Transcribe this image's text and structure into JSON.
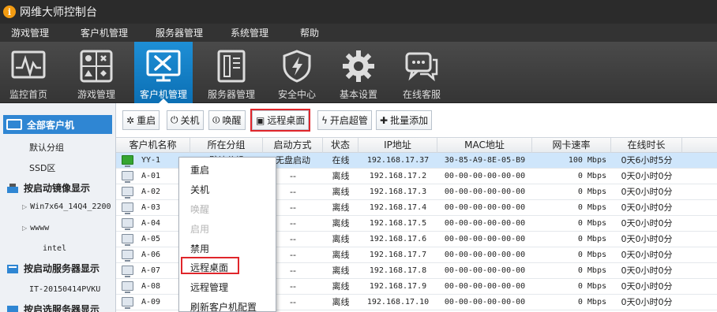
{
  "app": {
    "title": "网维大师控制台",
    "logo_glyph": "i"
  },
  "menu": [
    "游戏管理",
    "客户机管理",
    "服务器管理",
    "系统管理",
    "帮助"
  ],
  "toolbar": [
    {
      "label": "监控首页",
      "icon": "monitor-chart-icon"
    },
    {
      "label": "游戏管理",
      "icon": "game-cards-icon"
    },
    {
      "label": "客户机管理",
      "icon": "client-tools-icon",
      "active": true
    },
    {
      "label": "服务器管理",
      "icon": "server-icon"
    },
    {
      "label": "安全中心",
      "icon": "shield-bolt-icon"
    },
    {
      "label": "基本设置",
      "icon": "gear-icon"
    },
    {
      "label": "在线客服",
      "icon": "chat-icon"
    }
  ],
  "sidebar": {
    "all_clients": "全部客户机",
    "groups": [
      "默认分组",
      "SSD区"
    ],
    "boot_image_header": "按启动镜像显示",
    "images": [
      "Win7x64_14Q4_2200",
      "wwww",
      "intel"
    ],
    "boot_server_header": "按启动服务器显示",
    "servers": [
      "IT-20150414PVKU"
    ],
    "last_header": "按启选服务器显示"
  },
  "actions": [
    {
      "label": "重启",
      "glyph": "✲"
    },
    {
      "label": "关机",
      "glyph": "⏻"
    },
    {
      "label": "唤醒",
      "glyph": "⏼"
    },
    {
      "label": "远程桌面",
      "glyph": "▣"
    },
    {
      "label": "开启超管",
      "glyph": "ϟ"
    },
    {
      "label": "批量添加",
      "glyph": "✚"
    }
  ],
  "table": {
    "columns": [
      "客户机名称",
      "所在分组",
      "启动方式",
      "状态",
      "IP地址",
      "MAC地址",
      "网卡速率",
      "在线时长"
    ],
    "rows": [
      {
        "name": "YY-1",
        "group": "默认分组",
        "boot": "无盘启动",
        "status": "在线",
        "ip": "192.168.17.37",
        "mac": "30-85-A9-8E-05-B9",
        "speed": "100 Mbps",
        "uptime": "0天6小时5分",
        "online": true
      },
      {
        "name": "A-01",
        "group": "",
        "boot": "--",
        "status": "离线",
        "ip": "192.168.17.2",
        "mac": "00-00-00-00-00-00",
        "speed": "0 Mbps",
        "uptime": "0天0小时0分"
      },
      {
        "name": "A-02",
        "group": "",
        "boot": "--",
        "status": "离线",
        "ip": "192.168.17.3",
        "mac": "00-00-00-00-00-00",
        "speed": "0 Mbps",
        "uptime": "0天0小时0分"
      },
      {
        "name": "A-03",
        "group": "",
        "boot": "--",
        "status": "离线",
        "ip": "192.168.17.4",
        "mac": "00-00-00-00-00-00",
        "speed": "0 Mbps",
        "uptime": "0天0小时0分"
      },
      {
        "name": "A-04",
        "group": "",
        "boot": "--",
        "status": "离线",
        "ip": "192.168.17.5",
        "mac": "00-00-00-00-00-00",
        "speed": "0 Mbps",
        "uptime": "0天0小时0分"
      },
      {
        "name": "A-05",
        "group": "",
        "boot": "--",
        "status": "离线",
        "ip": "192.168.17.6",
        "mac": "00-00-00-00-00-00",
        "speed": "0 Mbps",
        "uptime": "0天0小时0分"
      },
      {
        "name": "A-06",
        "group": "",
        "boot": "--",
        "status": "离线",
        "ip": "192.168.17.7",
        "mac": "00-00-00-00-00-00",
        "speed": "0 Mbps",
        "uptime": "0天0小时0分"
      },
      {
        "name": "A-07",
        "group": "",
        "boot": "--",
        "status": "离线",
        "ip": "192.168.17.8",
        "mac": "00-00-00-00-00-00",
        "speed": "0 Mbps",
        "uptime": "0天0小时0分"
      },
      {
        "name": "A-08",
        "group": "",
        "boot": "--",
        "status": "离线",
        "ip": "192.168.17.9",
        "mac": "00-00-00-00-00-00",
        "speed": "0 Mbps",
        "uptime": "0天0小时0分"
      },
      {
        "name": "A-09",
        "group": "",
        "boot": "--",
        "status": "离线",
        "ip": "192.168.17.10",
        "mac": "00-00-00-00-00-00",
        "speed": "0 Mbps",
        "uptime": "0天0小时0分"
      }
    ]
  },
  "context_menu": [
    {
      "label": "重启",
      "disabled": false
    },
    {
      "label": "关机",
      "disabled": false
    },
    {
      "label": "唤醒",
      "disabled": true
    },
    {
      "label": "启用",
      "disabled": true
    },
    {
      "label": "禁用",
      "disabled": false
    },
    {
      "label": "远程桌面",
      "disabled": false,
      "highlighted": true
    },
    {
      "label": "远程管理",
      "disabled": false
    },
    {
      "label": "刷新客户机配置",
      "disabled": false
    }
  ],
  "colors": {
    "accent": "#2f86d3",
    "highlight_box": "#e0262b",
    "online": "#35a531",
    "selected_row": "#cfe6fb"
  }
}
